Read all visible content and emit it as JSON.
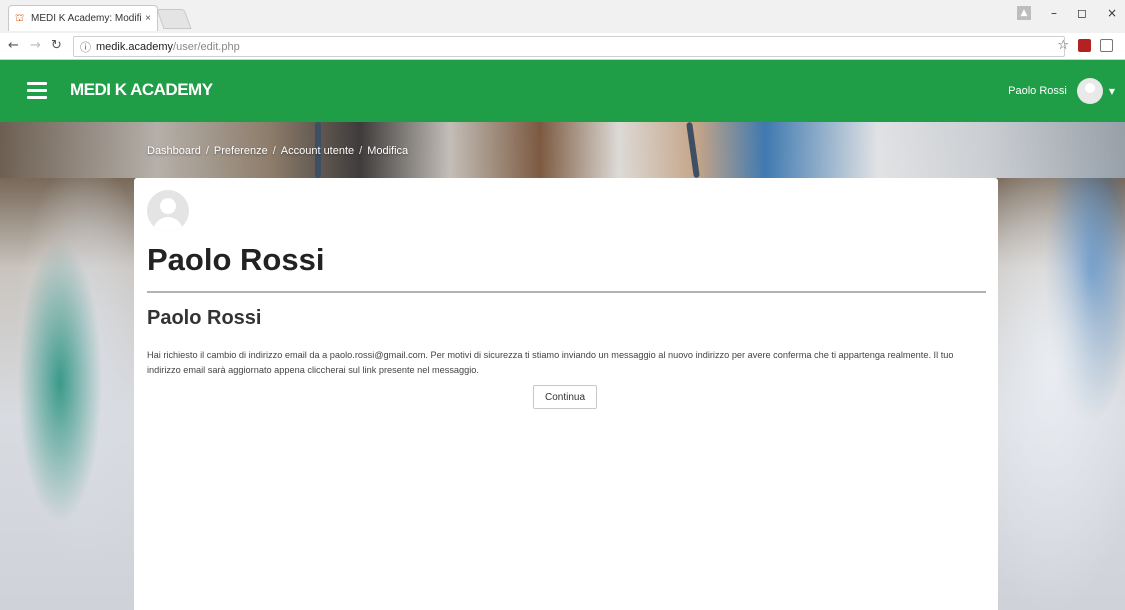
{
  "browser": {
    "tab_title": "MEDI K Academy: Modifi",
    "tab_close": "×",
    "url_host": "medik.academy",
    "url_path": "/user/edit.php",
    "controls": {
      "minimize": "–",
      "maximize": "◻",
      "close": "×"
    }
  },
  "header": {
    "brand": "MEDI K ACADEMY",
    "user_name": "Paolo Rossi",
    "accent_color": "#1f9d47"
  },
  "breadcrumb": {
    "items": [
      "Dashboard",
      "Preferenze",
      "Account utente",
      "Modifica"
    ],
    "separator": "/"
  },
  "main": {
    "page_title": "Paolo Rossi",
    "section_title": "Paolo Rossi",
    "message": "Hai richiesto il cambio di indirizzo email da a paolo.rossi@gmail.com. Per motivi di sicurezza ti stiamo inviando un messaggio al nuovo indirizzo per avere conferma che ti appartenga realmente. Il tuo indirizzo email sarà aggiornato appena cliccherai sul link presente nel messaggio.",
    "continue_label": "Continua"
  },
  "icons": [
    "favicon",
    "back-icon",
    "forward-icon",
    "reload-icon",
    "info-icon",
    "star-icon",
    "pdf-icon",
    "extension-icon",
    "hamburger-icon",
    "avatar-icon",
    "caret-down-icon"
  ]
}
